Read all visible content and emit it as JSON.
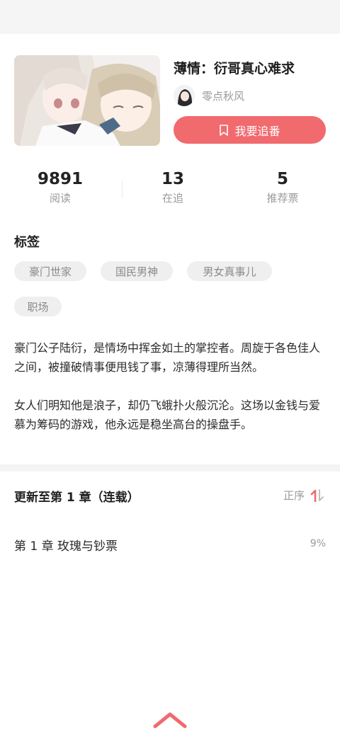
{
  "book": {
    "title": "薄情：衍哥真心难求",
    "author": "零点秋风",
    "follow_label": "我要追番"
  },
  "stats": [
    {
      "value": "9891",
      "label": "阅读"
    },
    {
      "value": "13",
      "label": "在追"
    },
    {
      "value": "5",
      "label": "推荐票"
    }
  ],
  "tags": {
    "title": "标签",
    "items": [
      "豪门世家",
      "国民男神",
      "男女真事儿",
      "职场"
    ]
  },
  "description": [
    "豪门公子陆衍，是情场中挥金如土的掌控者。周旋于各色佳人之间，被撞破情事便甩钱了事，凉薄得理所当然。",
    "女人们明知他是浪子，却仍飞蛾扑火般沉沦。这场以金钱与爱慕为筹码的游戏，他永远是稳坐高台的操盘手。"
  ],
  "chapters": {
    "header": "更新至第 1 章（连载）",
    "sort_label": "正序",
    "items": [
      {
        "title": "第 1 章  玫瑰与钞票",
        "progress": "9%"
      }
    ]
  },
  "colors": {
    "accent": "#f06a6e",
    "muted": "#9a9a9a",
    "tag_bg": "#efefef"
  }
}
